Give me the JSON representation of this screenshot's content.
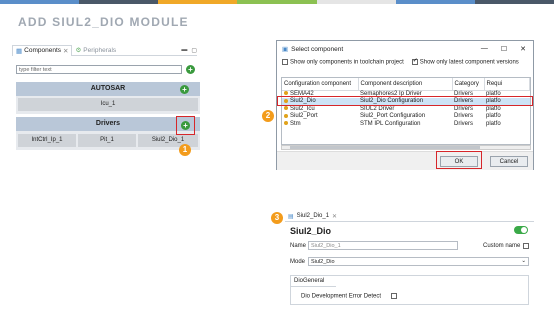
{
  "page_title": "ADD SIUL2_DIO MODULE",
  "colors": {
    "bar": [
      "#5a8ec9",
      "#4a5868",
      "#f0a828",
      "#8cc152",
      "#e5e5e5",
      "#5a8ec9",
      "#4a5868"
    ]
  },
  "left_panel": {
    "tabs": [
      {
        "label": "Components",
        "active": true
      },
      {
        "label": "Peripherals",
        "active": false
      }
    ],
    "filter_placeholder": "type filter text",
    "autosar": {
      "title": "AUTOSAR",
      "items": [
        "Icu_1"
      ]
    },
    "drivers": {
      "title": "Drivers",
      "items": [
        "IntCtrl_Ip_1",
        "Pit_1",
        "Siul2_Dio_1"
      ]
    },
    "step_badge": "1"
  },
  "dialog": {
    "title": "Select component",
    "opt1": "Show only components in toolchain project",
    "opt2": "Show only latest component versions",
    "columns": [
      "Configuration component",
      "Component description",
      "Category",
      "Requi"
    ],
    "rows": [
      [
        "SEMA42",
        "Semaphores2 Ip Driver",
        "Drivers",
        "platfo"
      ],
      [
        "Siul2_Dio",
        "Siul2_Dio Configuration",
        "Drivers",
        "platfo"
      ],
      [
        "Siul2_Icu",
        "SIUL2 Driver",
        "Drivers",
        "platfo"
      ],
      [
        "Siul2_Port",
        "Siul2_Port Configuration",
        "Drivers",
        "platfo"
      ],
      [
        "Stm",
        "STM IPL Configuration",
        "Drivers",
        "platfo"
      ]
    ],
    "selected_row": 1,
    "ok_label": "OK",
    "cancel_label": "Cancel",
    "step_badge": "2"
  },
  "editor": {
    "tab_label": "Siul2_Dio_1",
    "title": "Siul2_Dio",
    "name_label": "Name",
    "name_value": "Siul2_Dio_1",
    "custom_name_label": "Custom name",
    "mode_label": "Mode",
    "mode_value": "Siul2_Dio",
    "section_title": "DioGeneral",
    "error_detect_label": "Dio Development Error Detect",
    "step_badge": "3"
  }
}
